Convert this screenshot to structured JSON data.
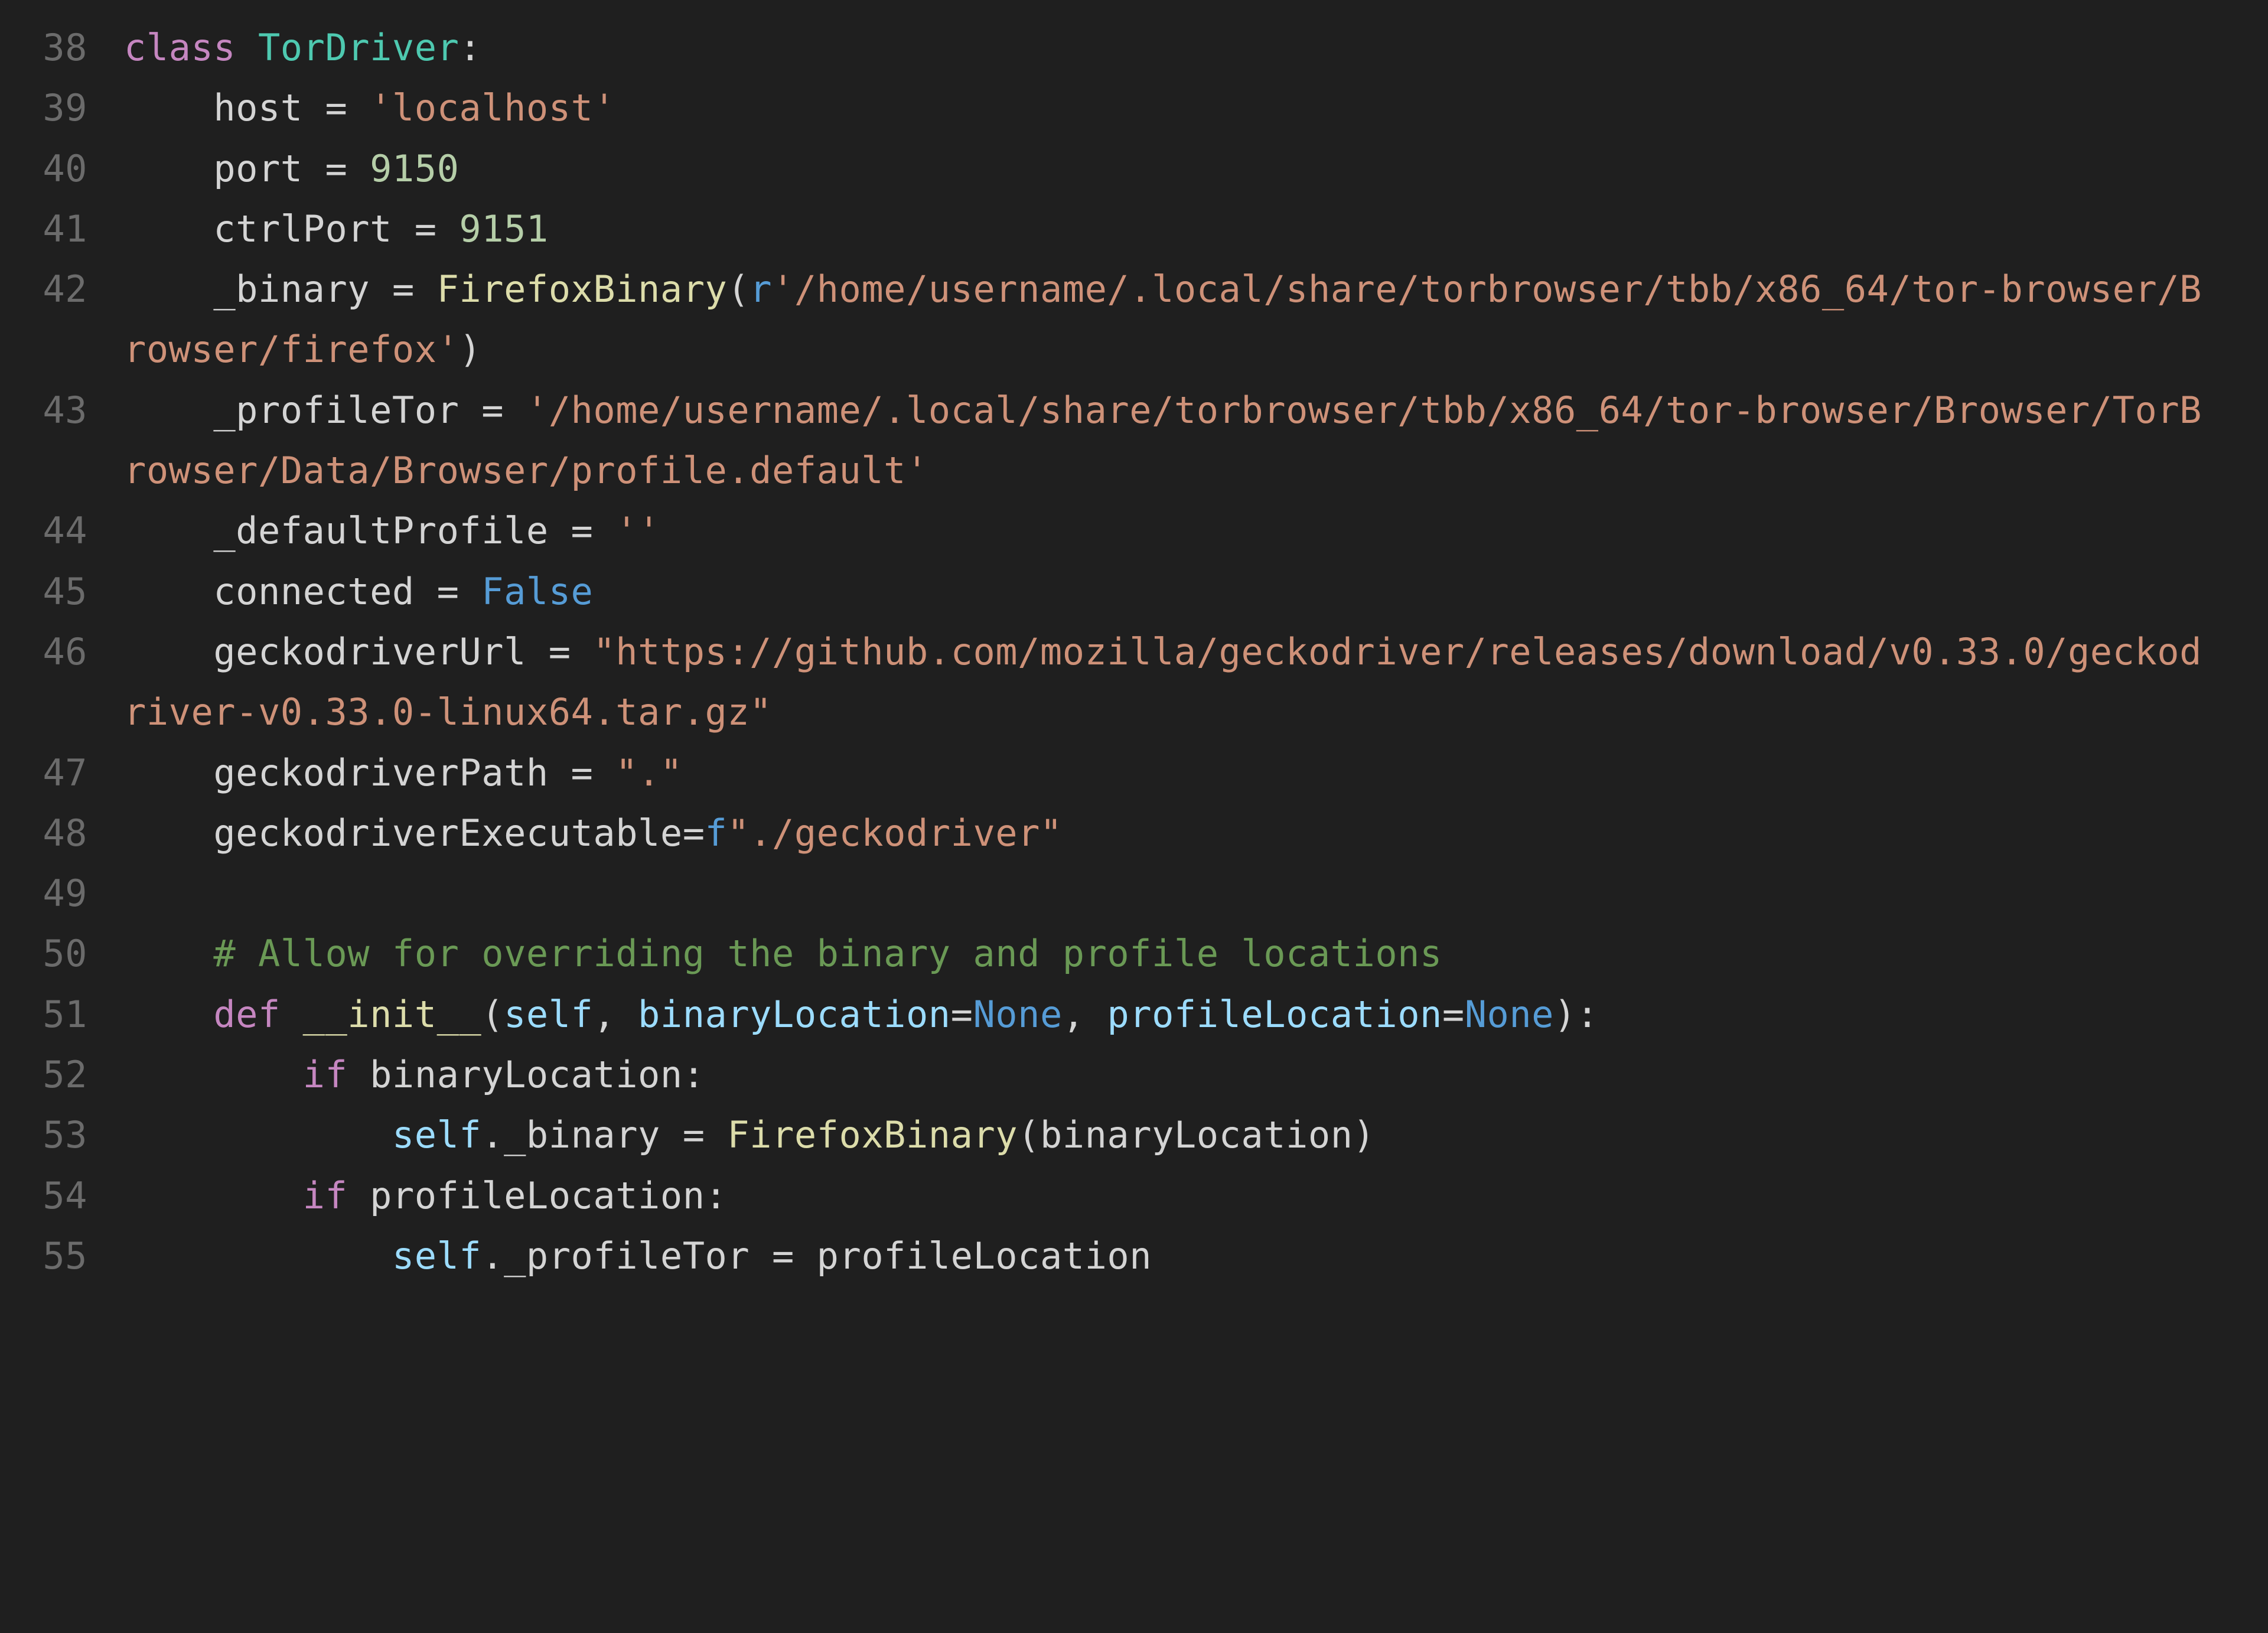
{
  "editor": {
    "lines": [
      {
        "num": "38",
        "indent": 0,
        "tokens": [
          {
            "t": "class ",
            "c": "kw"
          },
          {
            "t": "TorDriver",
            "c": "cls"
          },
          {
            "t": ":",
            "c": "pn"
          }
        ]
      },
      {
        "num": "39",
        "indent": 1,
        "tokens": [
          {
            "t": "host ",
            "c": "id"
          },
          {
            "t": "=",
            "c": "pn"
          },
          {
            "t": " ",
            "c": "pn"
          },
          {
            "t": "'localhost'",
            "c": "str"
          }
        ]
      },
      {
        "num": "40",
        "indent": 1,
        "tokens": [
          {
            "t": "port ",
            "c": "id"
          },
          {
            "t": "=",
            "c": "pn"
          },
          {
            "t": " ",
            "c": "pn"
          },
          {
            "t": "9150",
            "c": "num"
          }
        ]
      },
      {
        "num": "41",
        "indent": 1,
        "tokens": [
          {
            "t": "ctrlPort ",
            "c": "id"
          },
          {
            "t": "=",
            "c": "pn"
          },
          {
            "t": " ",
            "c": "pn"
          },
          {
            "t": "9151",
            "c": "num"
          }
        ]
      },
      {
        "num": "42",
        "indent": 1,
        "tokens": [
          {
            "t": "_binary ",
            "c": "id"
          },
          {
            "t": "=",
            "c": "pn"
          },
          {
            "t": " ",
            "c": "pn"
          },
          {
            "t": "FirefoxBinary",
            "c": "fn"
          },
          {
            "t": "(",
            "c": "pn"
          },
          {
            "t": "r",
            "c": "cst"
          },
          {
            "t": "'/home/username/.local/share/torbrowser/tbb/x86_64/tor-browser/Browser/firefox'",
            "c": "str"
          },
          {
            "t": ")",
            "c": "pn"
          }
        ]
      },
      {
        "num": "43",
        "indent": 1,
        "tokens": [
          {
            "t": "_profileTor ",
            "c": "id"
          },
          {
            "t": "=",
            "c": "pn"
          },
          {
            "t": " ",
            "c": "pn"
          },
          {
            "t": "'/home/username/.local/share/torbrowser/tbb/x86_64/tor-browser/Browser/TorBrowser/Data/Browser/profile.default'",
            "c": "str"
          }
        ]
      },
      {
        "num": "44",
        "indent": 1,
        "tokens": [
          {
            "t": "_defaultProfile ",
            "c": "id"
          },
          {
            "t": "=",
            "c": "pn"
          },
          {
            "t": " ",
            "c": "pn"
          },
          {
            "t": "''",
            "c": "str"
          }
        ]
      },
      {
        "num": "45",
        "indent": 1,
        "tokens": [
          {
            "t": "connected ",
            "c": "id"
          },
          {
            "t": "=",
            "c": "pn"
          },
          {
            "t": " ",
            "c": "pn"
          },
          {
            "t": "False",
            "c": "cst"
          }
        ]
      },
      {
        "num": "46",
        "indent": 1,
        "tokens": [
          {
            "t": "geckodriverUrl ",
            "c": "id"
          },
          {
            "t": "=",
            "c": "pn"
          },
          {
            "t": " ",
            "c": "pn"
          },
          {
            "t": "\"https://github.com/mozilla/geckodriver/releases/download/v0.33.0/geckodriver-v0.33.0-linux64.tar.gz\"",
            "c": "str"
          }
        ]
      },
      {
        "num": "47",
        "indent": 1,
        "tokens": [
          {
            "t": "geckodriverPath ",
            "c": "id"
          },
          {
            "t": "=",
            "c": "pn"
          },
          {
            "t": " ",
            "c": "pn"
          },
          {
            "t": "\".\"",
            "c": "str"
          }
        ]
      },
      {
        "num": "48",
        "indent": 1,
        "tokens": [
          {
            "t": "geckodriverExecutable",
            "c": "id"
          },
          {
            "t": "=",
            "c": "pn"
          },
          {
            "t": "f",
            "c": "cst"
          },
          {
            "t": "\"./geckodriver\"",
            "c": "str"
          }
        ]
      },
      {
        "num": "49",
        "indent": 0,
        "tokens": []
      },
      {
        "num": "50",
        "indent": 1,
        "tokens": [
          {
            "t": "# Allow for overriding the binary and profile locations",
            "c": "cmt"
          }
        ]
      },
      {
        "num": "51",
        "indent": 1,
        "tokens": [
          {
            "t": "def ",
            "c": "kw"
          },
          {
            "t": "__init__",
            "c": "dunder"
          },
          {
            "t": "(",
            "c": "pn"
          },
          {
            "t": "self",
            "c": "prm"
          },
          {
            "t": ", ",
            "c": "pn"
          },
          {
            "t": "binaryLocation",
            "c": "prm"
          },
          {
            "t": "=",
            "c": "pn"
          },
          {
            "t": "None",
            "c": "cst"
          },
          {
            "t": ", ",
            "c": "pn"
          },
          {
            "t": "profileLocation",
            "c": "prm"
          },
          {
            "t": "=",
            "c": "pn"
          },
          {
            "t": "None",
            "c": "cst"
          },
          {
            "t": "):",
            "c": "pn"
          }
        ]
      },
      {
        "num": "52",
        "indent": 2,
        "tokens": [
          {
            "t": "if ",
            "c": "kw"
          },
          {
            "t": "binaryLocation",
            "c": "id"
          },
          {
            "t": ":",
            "c": "pn"
          }
        ]
      },
      {
        "num": "53",
        "indent": 3,
        "tokens": [
          {
            "t": "self",
            "c": "slf"
          },
          {
            "t": "._binary ",
            "c": "id"
          },
          {
            "t": "=",
            "c": "pn"
          },
          {
            "t": " ",
            "c": "pn"
          },
          {
            "t": "FirefoxBinary",
            "c": "fn"
          },
          {
            "t": "(",
            "c": "pn"
          },
          {
            "t": "binaryLocation",
            "c": "id"
          },
          {
            "t": ")",
            "c": "pn"
          }
        ]
      },
      {
        "num": "54",
        "indent": 2,
        "tokens": [
          {
            "t": "if ",
            "c": "kw"
          },
          {
            "t": "profileLocation",
            "c": "id"
          },
          {
            "t": ":",
            "c": "pn"
          }
        ]
      },
      {
        "num": "55",
        "indent": 3,
        "tokens": [
          {
            "t": "self",
            "c": "slf"
          },
          {
            "t": "._profileTor ",
            "c": "id"
          },
          {
            "t": "=",
            "c": "pn"
          },
          {
            "t": " profileLocation",
            "c": "id"
          }
        ]
      }
    ],
    "indent_unit": "    "
  }
}
